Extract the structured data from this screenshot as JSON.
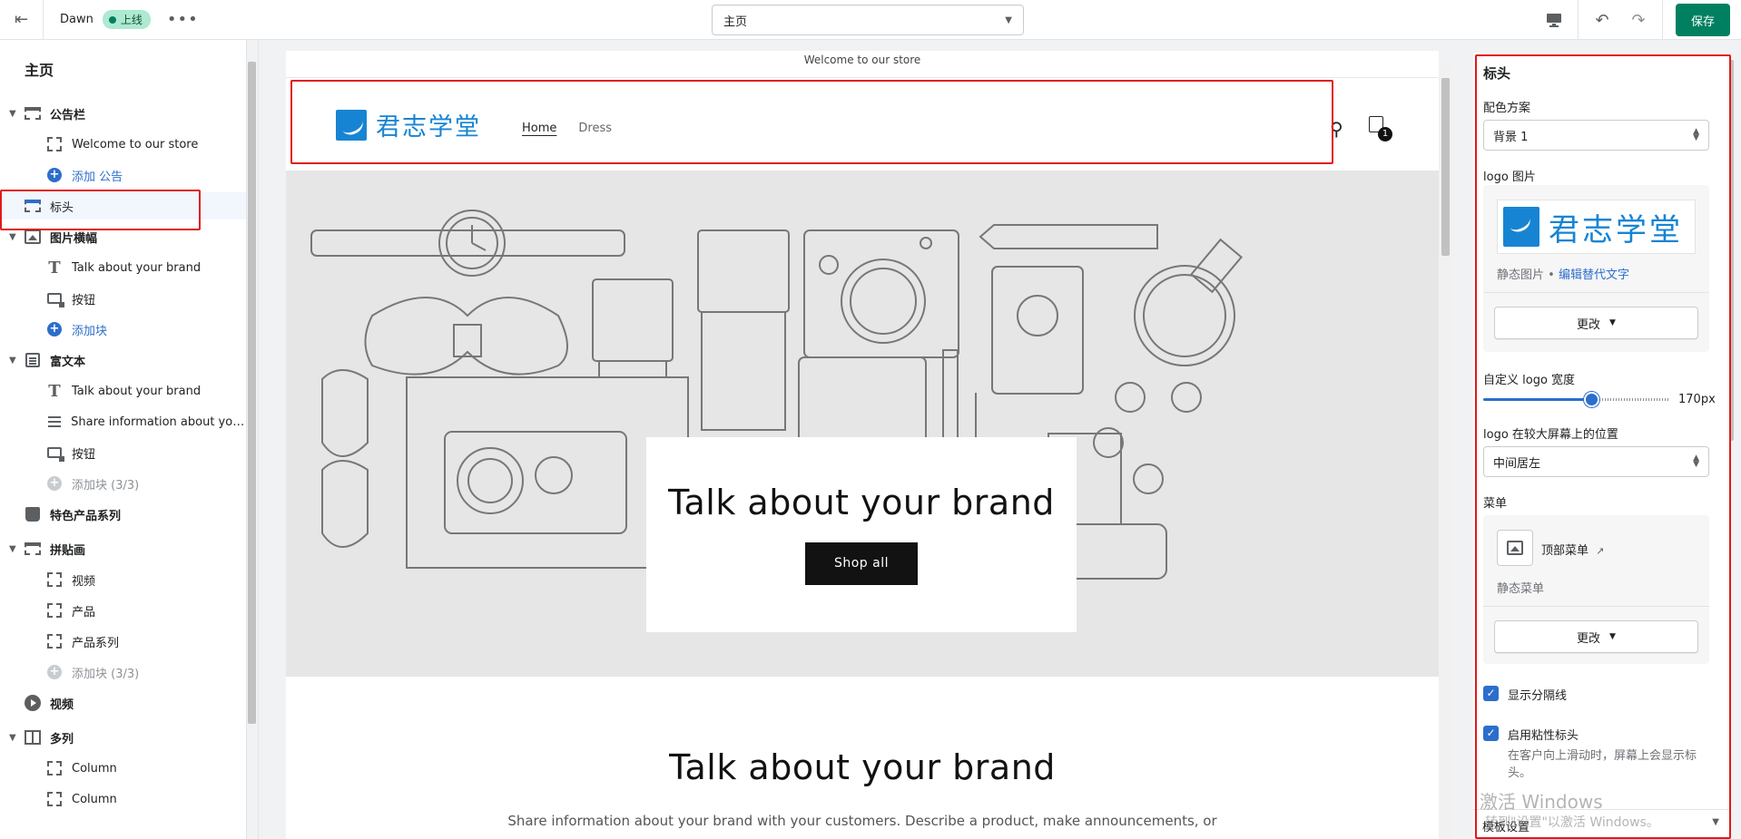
{
  "topbar": {
    "theme_name": "Dawn",
    "status": "上线",
    "page_select": "主页",
    "save_label": "保存"
  },
  "left": {
    "title": "主页",
    "rows": [
      {
        "label": "公告栏"
      },
      {
        "label": "Welcome to our store"
      },
      {
        "label": "添加 公告"
      },
      {
        "label": "标头"
      },
      {
        "label": "图片横幅"
      },
      {
        "label": "Talk about your brand"
      },
      {
        "label": "按钮"
      },
      {
        "label": "添加块"
      },
      {
        "label": "富文本"
      },
      {
        "label": "Talk about your brand"
      },
      {
        "label": "Share information about your..."
      },
      {
        "label": "按钮"
      },
      {
        "label": "添加块 (3/3)"
      },
      {
        "label": "特色产品系列"
      },
      {
        "label": "拼贴画"
      },
      {
        "label": "视频"
      },
      {
        "label": "产品"
      },
      {
        "label": "产品系列"
      },
      {
        "label": "添加块 (3/3)"
      },
      {
        "label": "视频"
      },
      {
        "label": "多列"
      },
      {
        "label": "Column"
      },
      {
        "label": "Column"
      }
    ]
  },
  "preview": {
    "announcement": "Welcome to our store",
    "logo_text": "君志学堂",
    "nav": [
      "Home",
      "Dress"
    ],
    "cart_count": "1",
    "hero_heading": "Talk about your brand",
    "hero_button": "Shop all",
    "richtext_heading": "Talk about your brand",
    "richtext_text": "Share information about your brand with your customers. Describe a product, make announcements, or"
  },
  "right": {
    "title": "标头",
    "color_scheme_label": "配色方案",
    "color_scheme_value": "背景 1",
    "logo_image_label": "logo 图片",
    "logo_text": "君志学堂",
    "logo_meta_prefix": "静态图片 • ",
    "logo_meta_link": "编辑替代文字",
    "change_label": "更改",
    "logo_width_label": "自定义 logo 宽度",
    "logo_width_value": "170px",
    "logo_width_fraction": 0.58,
    "logo_position_label": "logo 在较大屏幕上的位置",
    "logo_position_value": "中间居左",
    "menu_label": "菜单",
    "menu_name": "顶部菜单",
    "menu_meta": "静态菜单",
    "show_divider_label": "显示分隔线",
    "sticky_header_label": "启用粘性标头",
    "sticky_header_help": "在客户向上滑动时，屏幕上会显示标头。",
    "footer_label": "模板设置"
  },
  "watermark": {
    "line1": "激活 Windows",
    "line2": "转到\"设置\"以激活 Windows。"
  },
  "colors": {
    "accent": "#2c6ecb",
    "save": "#008060",
    "highlight": "#e01a1a",
    "logo_blue": "#1784d3"
  }
}
